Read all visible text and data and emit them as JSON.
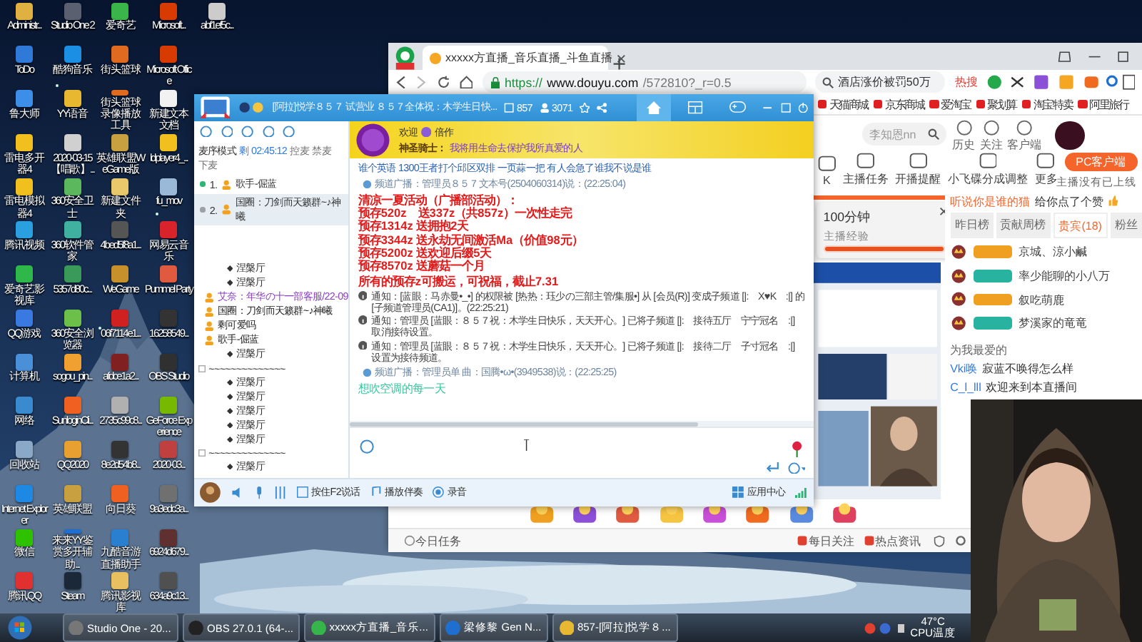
{
  "desktop_icons": [
    [
      {
        "label": "Administr...",
        "color": "#e0b040"
      },
      {
        "label": "Studio One 2",
        "color": "#5a6070"
      },
      {
        "label": "爱奇艺",
        "color": "#39b54a"
      },
      {
        "label": "Microsoft...",
        "color": "#d83b01"
      },
      {
        "label": "abf1ef5c...",
        "color": "#cccccc"
      }
    ],
    [
      {
        "label": "ToDo",
        "color": "#2f7ad8"
      },
      {
        "label": "酷狗音乐",
        "color": "#1a8fe3"
      },
      {
        "label": "街头篮球",
        "color": "#e06a20"
      },
      {
        "label": "Microsoft Office",
        "color": "#d83b01"
      }
    ],
    [
      {
        "label": "鲁大师",
        "color": "#3d8ee8"
      },
      {
        "label": "YY语音",
        "color": "#e8b830"
      },
      {
        "label": "街头篮球录像播放工具",
        "color": "#e06a20"
      },
      {
        "label": "新建文本文档",
        "color": "#f2f2f2"
      }
    ],
    [
      {
        "label": "雷电多开器4",
        "color": "#f2c01e"
      },
      {
        "label": "2020-03-15【唱歌】...",
        "color": "#d0d0d0"
      },
      {
        "label": "英雄联盟WeGame版",
        "color": "#c8a040"
      },
      {
        "label": "ldplayer4_...",
        "color": "#f2c01e"
      }
    ],
    [
      {
        "label": "雷电模拟器4",
        "color": "#f2c01e"
      },
      {
        "label": "360安全卫士",
        "color": "#5cb85c"
      },
      {
        "label": "新建文件夹",
        "color": "#e8c86a"
      },
      {
        "label": "fu_mov",
        "color": "#9ab8d8"
      }
    ],
    [
      {
        "label": "腾讯视频",
        "color": "#2ba0e0"
      },
      {
        "label": "360软件管家",
        "color": "#40b0a0"
      },
      {
        "label": "4bed5f8a1...",
        "color": "#555555"
      },
      {
        "label": "网易云音乐",
        "color": "#d8232a"
      }
    ],
    [
      {
        "label": "爱奇艺影视库",
        "color": "#2fb84a"
      },
      {
        "label": "5357d80c...",
        "color": "#3a9a5a"
      },
      {
        "label": "WeGame",
        "color": "#c8902a"
      },
      {
        "label": "Pummel Party",
        "color": "#e05a40"
      }
    ],
    [
      {
        "label": "QQ游戏",
        "color": "#3a7ae0"
      },
      {
        "label": "360安全浏览器",
        "color": "#6cc04a"
      },
      {
        "label": "06f7114e1...",
        "color": "#d02020"
      },
      {
        "label": "16258549...",
        "color": "#333333"
      }
    ],
    [
      {
        "label": "计算机",
        "color": "#4a90d9"
      },
      {
        "label": "sogou_pin...",
        "color": "#f0a030"
      },
      {
        "label": "afdce1a2...",
        "color": "#802020"
      },
      {
        "label": "OBS Studio",
        "color": "#303030"
      }
    ],
    [
      {
        "label": "网络",
        "color": "#3a8ad0"
      },
      {
        "label": "SunloginCli...",
        "color": "#f06020"
      },
      {
        "label": "2735c99c8...",
        "color": "#b0b0b0"
      },
      {
        "label": "GeForce Experience",
        "color": "#76b900"
      }
    ],
    [
      {
        "label": "回收站",
        "color": "#8aa8c8"
      },
      {
        "label": "QQ2020",
        "color": "#e8a030"
      },
      {
        "label": "8e2d54b8...",
        "color": "#333333"
      },
      {
        "label": "2020-03...",
        "color": "#c04040"
      }
    ],
    [
      {
        "label": "Internet Explorer",
        "color": "#1e88e5"
      },
      {
        "label": "英雄联盟",
        "color": "#c8a040"
      },
      {
        "label": "向日葵",
        "color": "#f06020"
      },
      {
        "label": "9a3edc3a...",
        "color": "#707070"
      }
    ],
    [
      {
        "label": "微信",
        "color": "#2dc100"
      },
      {
        "label": "来来YY鉴赏多开辅助...",
        "color": "#1e6fd0"
      },
      {
        "label": "九酷音游直播助手",
        "color": "#2a80d0"
      },
      {
        "label": "6924d679...",
        "color": "#603030"
      }
    ],
    [
      {
        "label": "腾讯QQ",
        "color": "#e03030"
      },
      {
        "label": "Steam",
        "color": "#1b2838"
      },
      {
        "label": "腾讯影视库",
        "color": "#e8c060"
      },
      {
        "label": "634a9c13...",
        "color": "#505050"
      }
    ]
  ],
  "browser": {
    "tabs": [
      {
        "title": "xxxxx方直播_音乐直播_斗鱼直播",
        "selected": true
      }
    ],
    "url": {
      "scheme": "https://",
      "host": "www.douyu.com",
      "path": "/572810?_r=0.5"
    },
    "search": {
      "value": "酒店涨价被罚50万",
      "tag": "热搜"
    },
    "bookmarks": [
      "天猫商城",
      "京东商城",
      "爱淘宝",
      "聚划算",
      "淘宝特卖",
      "阿里旅行"
    ],
    "page": {
      "search_placeholder": "李知恩nn",
      "header_links": [
        "历史",
        "关注",
        "客户端"
      ],
      "nav": [
        "K",
        "主播任务",
        "开播提醒",
        "小飞碟分成调整",
        "更多"
      ],
      "pc_client": "PC客户端",
      "pc_note": "主播没有已上线",
      "task": {
        "title": "100分钟",
        "subtitle": "主播经验",
        "level": 1
      },
      "greeting": {
        "user": "听说你是谁的猫",
        "text": "给你点了个赞"
      },
      "rank_tabs": [
        {
          "label": "昨日榜",
          "selected": false
        },
        {
          "label": "贡献周榜",
          "selected": false
        },
        {
          "label": "贵宾(18)",
          "selected": true
        },
        {
          "label": "粉丝",
          "selected": false
        }
      ],
      "guests": [
        {
          "name": "京城、涼小鹹",
          "color": "#f0a020"
        },
        {
          "name": "率少能聊的小八万",
          "color": "#27b3a0"
        },
        {
          "name": "叙吃萌鹿",
          "color": "#f0a020"
        },
        {
          "name": "梦溪家的竜竜",
          "color": "#27b3a0"
        }
      ],
      "chat_title": "为我最爱的",
      "chat": [
        {
          "user": "Vki唤",
          "text": "寂蓝不唤得怎么样"
        },
        {
          "user": "C_l_lll",
          "text": "欢迎来到本直播间"
        }
      ],
      "bottom_left": "今日任务",
      "bottom_links": [
        "每日关注",
        "热点资讯"
      ]
    }
  },
  "yy": {
    "title": "[阿拉]悦学８５７ 试营业 ８５７全体祝：木学生日快...",
    "channel_id": "857",
    "online": "3071",
    "mode": "麦序模式",
    "timer": "剩 02:45:12",
    "mic_controls": [
      "控麦",
      "禁麦",
      "下麦"
    ],
    "mic_queue": [
      {
        "num": "1.",
        "name": "歌手-倔蓝",
        "selected": false,
        "color": "#2bb673"
      },
      {
        "num": "2.",
        "name": "国圈：刀剑而天籁群~♪神曦",
        "selected": true,
        "color": "#9aa0a6"
      }
    ],
    "tree": [
      {
        "kind": "channel",
        "label": "涅槃厅"
      },
      {
        "kind": "channel",
        "label": "涅槃厅",
        "children": [
          {
            "kind": "user",
            "label": "艾奈：年华の十一部客服/22-09",
            "color": "#8a3fc0"
          },
          {
            "kind": "user",
            "label": "国圈：刀剑而天籁群~♪神曦",
            "color": "#222222"
          },
          {
            "kind": "user",
            "label": "剩可爱吗",
            "color": "#222222"
          },
          {
            "kind": "user",
            "label": "歌手-倔蓝",
            "color": "#222222"
          }
        ]
      },
      {
        "kind": "channel",
        "label": "涅槃厅"
      },
      {
        "kind": "group",
        "label": "~~~~~~~~~~~~~~",
        "children": [
          {
            "kind": "channel",
            "label": "涅槃厅"
          },
          {
            "kind": "channel",
            "label": "涅槃厅"
          },
          {
            "kind": "channel",
            "label": "涅槃厅"
          },
          {
            "kind": "channel",
            "label": "涅槃厅"
          },
          {
            "kind": "channel",
            "label": "涅槃厅"
          }
        ]
      },
      {
        "kind": "group",
        "label": "~~~~~~~~~~~~~~",
        "children": [
          {
            "kind": "channel",
            "label": "涅槃厅"
          }
        ]
      }
    ],
    "messages": [
      {
        "kind": "welcome",
        "greeting": "欢迎",
        "user": "倍作",
        "title": "神圣骑士：",
        "motto": "我将用生命去保护我所真爱的人"
      },
      {
        "kind": "plain",
        "text": "谁个英语 1300王者打个邱区双排 一页蒜一把 有人会急了谁我不说是谁"
      },
      {
        "kind": "broadcast",
        "text": "频道广播：管理员８５７文本号(2504060314)说：(22:25:04)"
      },
      {
        "kind": "promo",
        "lines": [
          "清凉一夏活动（广播部活动）：",
          "预存520z　送337z（共857z）一次性走完",
          "预存1314z 送拥抱2天",
          "预存3344z 送永劫无间激活Ma（价值98元）",
          "预存5200z 送欢迎后缀5天",
          "预存8570z 送蘑菇一个月"
        ]
      },
      {
        "kind": "promo",
        "lines": [
          "所有的预存z可搬运，可祝福，截止7.31"
        ]
      },
      {
        "kind": "notice",
        "text": "通知：[蓝眼：马赤曼•_•] 的权限被 [热热：珏少の三部主管/集服•] 从 [会员(R)] 变成子频道 [|:　X♥K　:|] 的 [子频道管理员(CA1)]。(22:25:21)"
      },
      {
        "kind": "notice",
        "text": "通知：管理员 [蓝眼：８５７祝：木学生日快乐，天天开心。] 已将子频道 [|:　接待五厅　宁宁冠名　:|] 取消接待设置。"
      },
      {
        "kind": "notice",
        "text": "通知：管理员 [蓝眼：８５７祝：木学生日快乐，天天开心。] 已将子频道 [|:　接待二厅　子寸冠名　:|] 设置为接待频道。"
      },
      {
        "kind": "broadcast",
        "text": "频道广播：管理员单 曲：国腾•ω•(3949538)说：(22:25:25)"
      },
      {
        "kind": "say",
        "text": "想吹空调的每一天"
      }
    ],
    "tools": [
      "按住F2说话",
      "播放伴奏",
      "录音"
    ],
    "app_center": "应用中心"
  },
  "taskbar": {
    "items": [
      "Studio One - 20...",
      "OBS 27.0.1 (64-...",
      "xxxxx方直播_音乐...",
      "梁修黎 Gen N...",
      "857-[阿拉]悦学８..."
    ],
    "temp": "47°C",
    "temp_label": "CPU温度"
  }
}
